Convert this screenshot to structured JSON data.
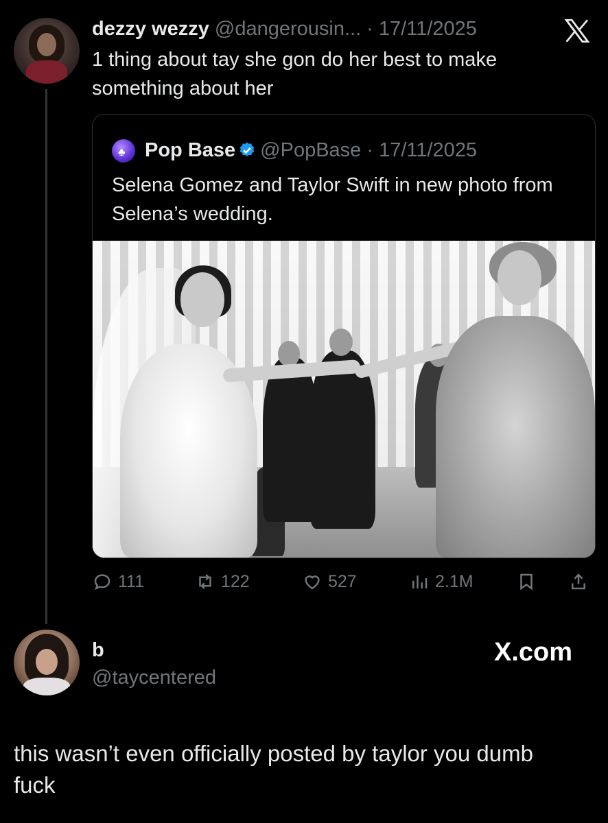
{
  "top_tweet": {
    "name": "dezzy wezzy",
    "handle_date": "@dangerousin... · 17/11/2025",
    "text": "1 thing about tay she gon do her best to make something about her"
  },
  "quoted_tweet": {
    "name": "Pop Base",
    "handle_date": "@PopBase · 17/11/2025",
    "text": "Selena Gomez and Taylor Swift in new photo from Selena’s wedding."
  },
  "actions": {
    "replies": "111",
    "reposts": "122",
    "likes": "527",
    "views": "2.1M"
  },
  "reply_tweet": {
    "name": "b",
    "handle": "@taycentered",
    "watermark": "X.com",
    "text": "this wasn’t even officially posted by taylor you dumb fuck"
  },
  "icons": [
    "x-logo-icon",
    "verified-badge-icon",
    "reply-icon",
    "repost-icon",
    "like-icon",
    "views-icon",
    "bookmark-icon",
    "share-icon"
  ],
  "colors": {
    "background": "#000000",
    "text": "#e7e9ea",
    "muted": "#71767b",
    "verified": "#1d9bf0",
    "border": "#2f3336"
  }
}
